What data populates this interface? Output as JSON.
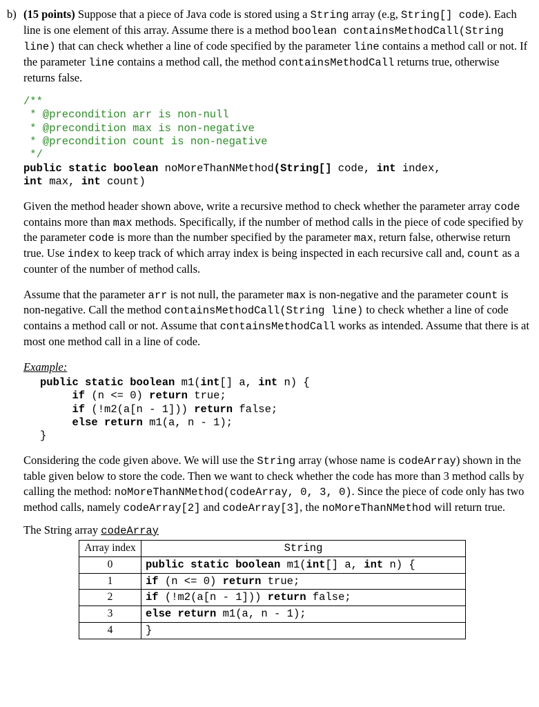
{
  "label": "b)",
  "points": "(15 points)",
  "intro_1": " Suppose that a piece of Java code is stored using a ",
  "intro_2": "String",
  "intro_3": " array (e.g, ",
  "intro_4": "String[] code",
  "intro_5": "). Each line is one element of this array. Assume there is a method ",
  "intro_6": "boolean containsMethodCall(String line)",
  "intro_7": " that can check whether a line of code specified by the parameter ",
  "intro_8": "line",
  "intro_9": " contains a method call or not. If the parameter ",
  "intro_10": "line",
  "intro_11": " contains a method call, the method ",
  "intro_12": "containsMethodCall",
  "intro_13": " returns true, otherwise returns false.",
  "jdoc_open": "/**",
  "jdoc_l1": " * @precondition arr is non-null",
  "jdoc_l2": " * @precondition max is non-negative",
  "jdoc_l3": " * @precondition count is non-negative",
  "jdoc_close": " */",
  "sig_1": "public static boolean ",
  "sig_2": "noMoreThanNMethod",
  "sig_3": "(String[] ",
  "sig_4": "code, ",
  "sig_5": "int ",
  "sig_6": "index, ",
  "sig_7": "int ",
  "sig_8": "max, ",
  "sig_9": "int ",
  "sig_10": "count)",
  "p2_1": "Given the method header shown above, write a recursive method to check whether the parameter array ",
  "p2_2": "code",
  "p2_3": " contains more than ",
  "p2_4": "max",
  "p2_5": " methods. Specifically, if the number of method calls in the piece of code specified by the parameter ",
  "p2_6": "code",
  "p2_7": " is more than the number specified by the parameter ",
  "p2_8": "max",
  "p2_9": ", return false, otherwise return true. Use ",
  "p2_10": "index",
  "p2_11": " to keep track of which array index is being inspected in each recursive call and, ",
  "p2_12": "count",
  "p2_13": " as a counter of the number of method calls.",
  "p3_1": "Assume that the parameter ",
  "p3_2": "arr",
  "p3_3": " is not null, the parameter ",
  "p3_4": "max",
  "p3_5": " is non-negative and the parameter ",
  "p3_6": "count",
  "p3_7": " is non-negative. Call the method ",
  "p3_8": "containsMethodCall(String line)",
  "p3_9": " to check whether a line of code contains a method call or not.  Assume that ",
  "p3_10": "containsMethodCall",
  "p3_11": " works as intended. Assume that there is at most one method call in a line of code.",
  "example_label": "Example:",
  "ex_l1a": "public static boolean ",
  "ex_l1b": "m1(",
  "ex_l1c": "int",
  "ex_l1d": "[] a, ",
  "ex_l1e": "int",
  "ex_l1f": " n) {",
  "ex_l2a": "     if ",
  "ex_l2b": "(n <= 0) ",
  "ex_l2c": "return ",
  "ex_l2d": "true;",
  "ex_l3a": "     if ",
  "ex_l3b": "(!m2(a[n - 1])) ",
  "ex_l3c": "return ",
  "ex_l3d": "false;",
  "ex_l4a": "     else return ",
  "ex_l4b": "m1(a, n - 1);",
  "ex_l5": "}",
  "p4_1": "Considering the code given above. We will use the ",
  "p4_2": "String",
  "p4_3": " array (whose name is ",
  "p4_4": "codeArray",
  "p4_5": ") shown in the table given below to store the code.  Then we want to check whether the code has more than 3 method calls by calling the method: ",
  "p4_6": "noMoreThanNMethod(codeArray, 0, 3, 0)",
  "p4_7": ". Since the piece of code only has two method calls, namely ",
  "p4_8": "codeArray[2]",
  "p4_9": " and ",
  "p4_10": "codeArray[3]",
  "p4_11": ", the ",
  "p4_12": "noMoreThanNMethod",
  "p4_13": " will return true.",
  "table_title_1": "The String array ",
  "table_title_2": "codeArray",
  "th_idx": "Array index",
  "th_str": "String",
  "rows": [
    {
      "idx": "0",
      "pre1": "public static boolean ",
      "mid": "m1(",
      "pre2": "int",
      "mid2": "[] a,  ",
      "pre3": "int",
      "tail": " n) {"
    },
    {
      "idx": "1",
      "pre1": "if ",
      "mid": "(n <= 0)  ",
      "pre2": "return ",
      "tail": "true;"
    },
    {
      "idx": "2",
      "pre1": "if ",
      "mid": "(!m2(a[n - 1]))  ",
      "pre2": "return ",
      "tail": "false;"
    },
    {
      "idx": "3",
      "pre1": "else return ",
      "tail": "m1(a, n - 1);"
    },
    {
      "idx": "4",
      "tail": "}"
    }
  ]
}
